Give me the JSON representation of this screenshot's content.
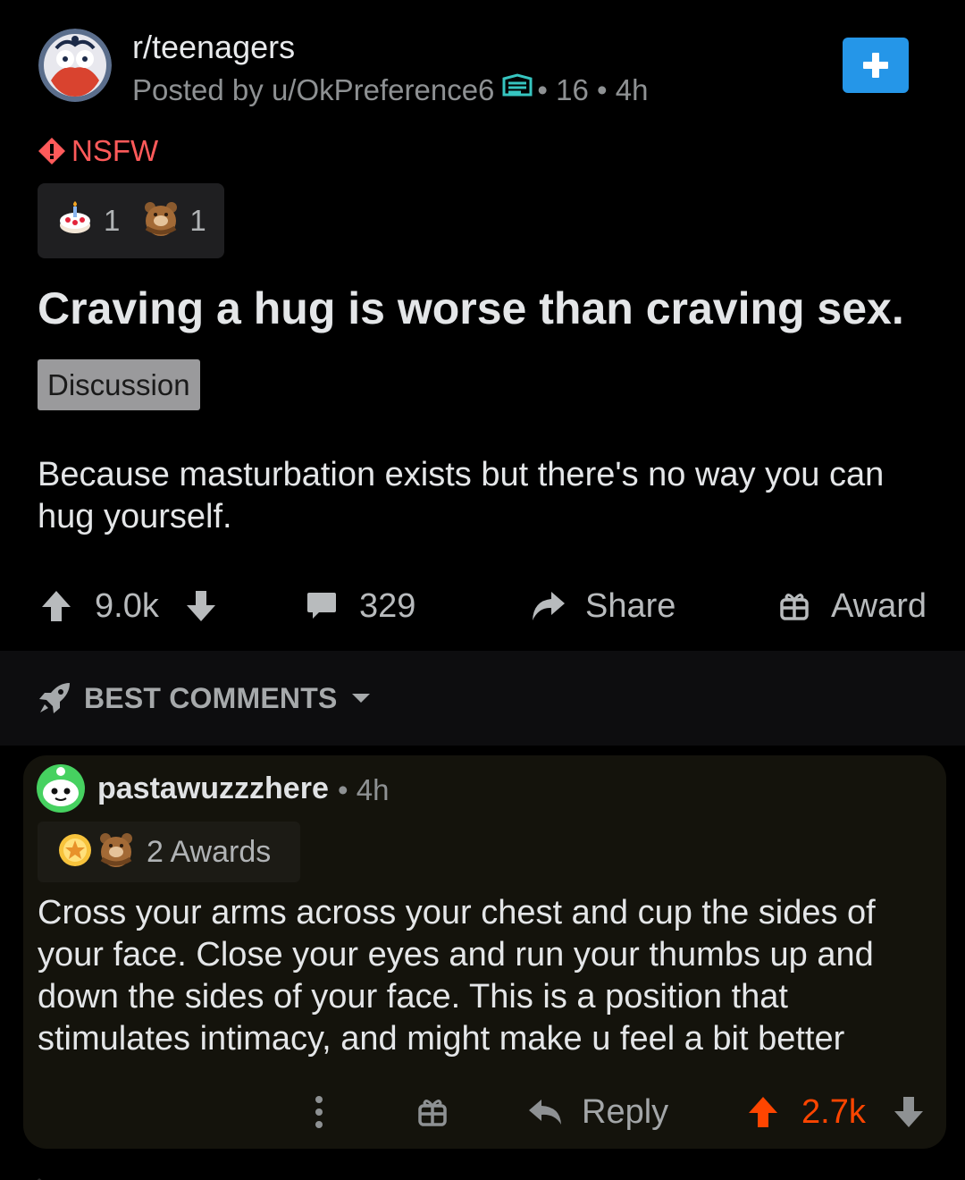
{
  "post": {
    "subreddit": "r/teenagers",
    "posted_by_prefix": "Posted by",
    "author": "u/OkPreference6",
    "separator": "•",
    "score_badge": "16",
    "age": "4h",
    "nsfw_label": "NSFW",
    "awards": [
      {
        "icon": "cake-award-icon",
        "count": "1"
      },
      {
        "icon": "bear-hug-award-icon",
        "count": "1"
      }
    ],
    "title": "Craving a hug is worse than craving sex.",
    "flair": "Discussion",
    "body": "Because masturbation exists but there's no way you can hug yourself.",
    "votes": "9.0k",
    "comments_count": "329",
    "share_label": "Share",
    "award_label": "Award"
  },
  "sort": {
    "label": "BEST COMMENTS"
  },
  "comment": {
    "author": "pastawuzzzhere",
    "age": "4h",
    "awards_label": "2 Awards",
    "body": "Cross your arms across your chest and cup the sides of your face. Close your eyes and run your thumbs up and down the sides of your face. This is a position that stimulates intimacy, and might make u feel a bit better",
    "reply_label": "Reply",
    "votes": "2.7k"
  },
  "colors": {
    "background": "#000000",
    "join_button": "#2596e8",
    "nsfw": "#ff5a5a",
    "upvoted": "#ff4500",
    "flair_bg": "#9a9a9c",
    "comment_bg": "#14130c"
  }
}
